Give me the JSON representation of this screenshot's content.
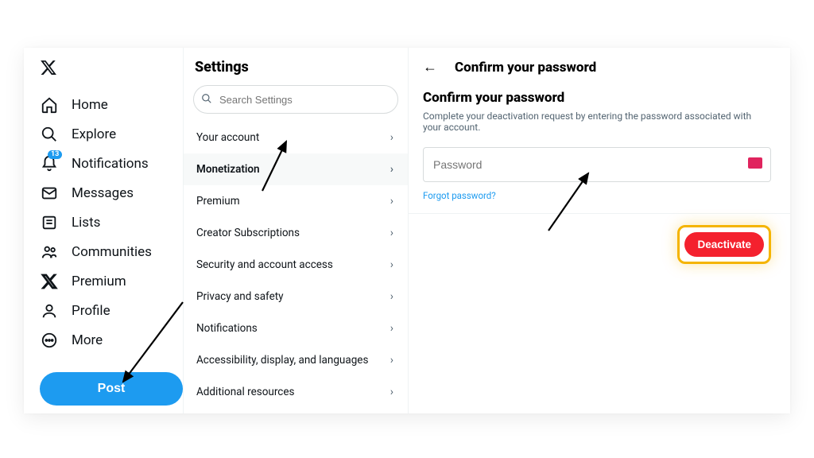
{
  "sidebar": {
    "notif_badge": "13",
    "items": [
      {
        "label": "Home"
      },
      {
        "label": "Explore"
      },
      {
        "label": "Notifications"
      },
      {
        "label": "Messages"
      },
      {
        "label": "Lists"
      },
      {
        "label": "Communities"
      },
      {
        "label": "Premium"
      },
      {
        "label": "Profile"
      },
      {
        "label": "More"
      }
    ],
    "post_label": "Post"
  },
  "settings": {
    "title": "Settings",
    "search_placeholder": "Search Settings",
    "items": [
      {
        "label": "Your account"
      },
      {
        "label": "Monetization"
      },
      {
        "label": "Premium"
      },
      {
        "label": "Creator Subscriptions"
      },
      {
        "label": "Security and account access"
      },
      {
        "label": "Privacy and safety"
      },
      {
        "label": "Notifications"
      },
      {
        "label": "Accessibility, display, and languages"
      },
      {
        "label": "Additional resources"
      }
    ]
  },
  "detail": {
    "header": "Confirm your password",
    "subtitle": "Confirm your password",
    "helper": "Complete your deactivation request by entering the password associated with your account.",
    "password_placeholder": "Password",
    "forgot": "Forgot password?",
    "deactivate": "Deactivate"
  }
}
